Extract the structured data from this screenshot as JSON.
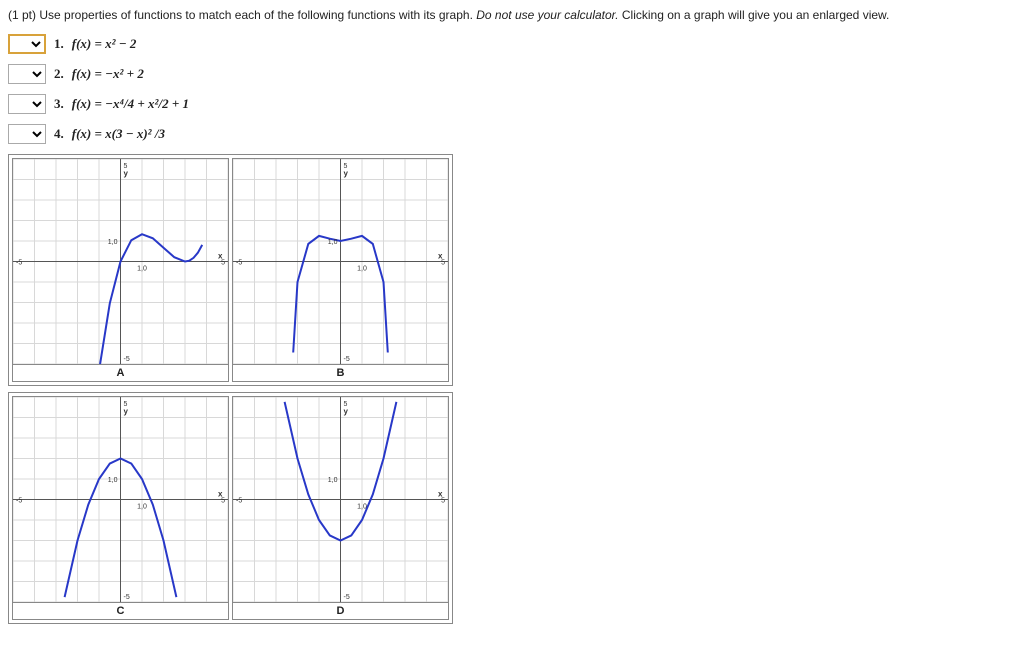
{
  "instruction_pre": "(1 pt) Use properties of functions to match each of the following functions with its graph. ",
  "instruction_em": "Do not use your calculator.",
  "instruction_post": " Clicking on a graph will give you an enlarged view.",
  "functions": [
    {
      "num": "1.",
      "math": "f(x) = x² − 2",
      "selected": true
    },
    {
      "num": "2.",
      "math": "f(x) = −x² + 2",
      "selected": false
    },
    {
      "num": "3.",
      "math": "f(x) = −x⁴/4 + x²/2 + 1",
      "selected": false
    },
    {
      "num": "4.",
      "math": "f(x) = x(3 − x)² /3",
      "selected": false
    }
  ],
  "graphs": {
    "A": {
      "label": "A"
    },
    "B": {
      "label": "B"
    },
    "C": {
      "label": "C"
    },
    "D": {
      "label": "D"
    }
  },
  "axis": {
    "xmin": -5,
    "xmax": 5,
    "ymin": -5,
    "ymax": 5,
    "xtick_neg": "-5",
    "xtick_pos": "5",
    "ytick_neg": "-5",
    "ytick_pos": "5",
    "unit_yx": "1,0",
    "unit_xy": "1,0",
    "xlabel": "x",
    "ylabel": "y"
  },
  "chart_data": [
    {
      "type": "line",
      "id": "A",
      "title": "",
      "xlabel": "x",
      "ylabel": "y",
      "xlim": [
        -5,
        5
      ],
      "ylim": [
        -5,
        5
      ],
      "function": "x*(3-x)^2 / 3",
      "x": [
        -1.0,
        -0.5,
        0,
        0.5,
        1.0,
        1.5,
        2.0,
        2.5,
        3.0,
        3.2,
        3.4,
        3.6,
        3.8
      ],
      "y": [
        -5.33,
        -2.04,
        0,
        1.04,
        1.33,
        1.13,
        0.67,
        0.21,
        0,
        0.04,
        0.18,
        0.43,
        0.81
      ]
    },
    {
      "type": "line",
      "id": "B",
      "title": "",
      "xlabel": "x",
      "ylabel": "y",
      "xlim": [
        -5,
        5
      ],
      "ylim": [
        -5,
        5
      ],
      "function": "-x^4/4 + x^2/2 + 1",
      "x": [
        -2.2,
        -2.0,
        -1.5,
        -1.0,
        -0.5,
        0,
        0.5,
        1.0,
        1.5,
        2.0,
        2.2
      ],
      "y": [
        -4.44,
        -1.0,
        0.86,
        1.25,
        1.11,
        1.0,
        1.11,
        1.25,
        0.86,
        -1.0,
        -4.44
      ]
    },
    {
      "type": "line",
      "id": "C",
      "title": "",
      "xlabel": "x",
      "ylabel": "y",
      "xlim": [
        -5,
        5
      ],
      "ylim": [
        -5,
        5
      ],
      "function": "-x^2 + 2",
      "x": [
        -2.6,
        -2.0,
        -1.5,
        -1.0,
        -0.5,
        0,
        0.5,
        1.0,
        1.5,
        2.0,
        2.6
      ],
      "y": [
        -4.76,
        -2.0,
        -0.25,
        1.0,
        1.75,
        2.0,
        1.75,
        1.0,
        -0.25,
        -2.0,
        -4.76
      ]
    },
    {
      "type": "line",
      "id": "D",
      "title": "",
      "xlabel": "x",
      "ylabel": "y",
      "xlim": [
        -5,
        5
      ],
      "ylim": [
        -5,
        5
      ],
      "function": "x^2 - 2",
      "x": [
        -2.6,
        -2.0,
        -1.5,
        -1.0,
        -0.5,
        0,
        0.5,
        1.0,
        1.5,
        2.0,
        2.6
      ],
      "y": [
        4.76,
        2.0,
        0.25,
        -1.0,
        -1.75,
        -2.0,
        -1.75,
        -1.0,
        0.25,
        2.0,
        4.76
      ]
    }
  ]
}
